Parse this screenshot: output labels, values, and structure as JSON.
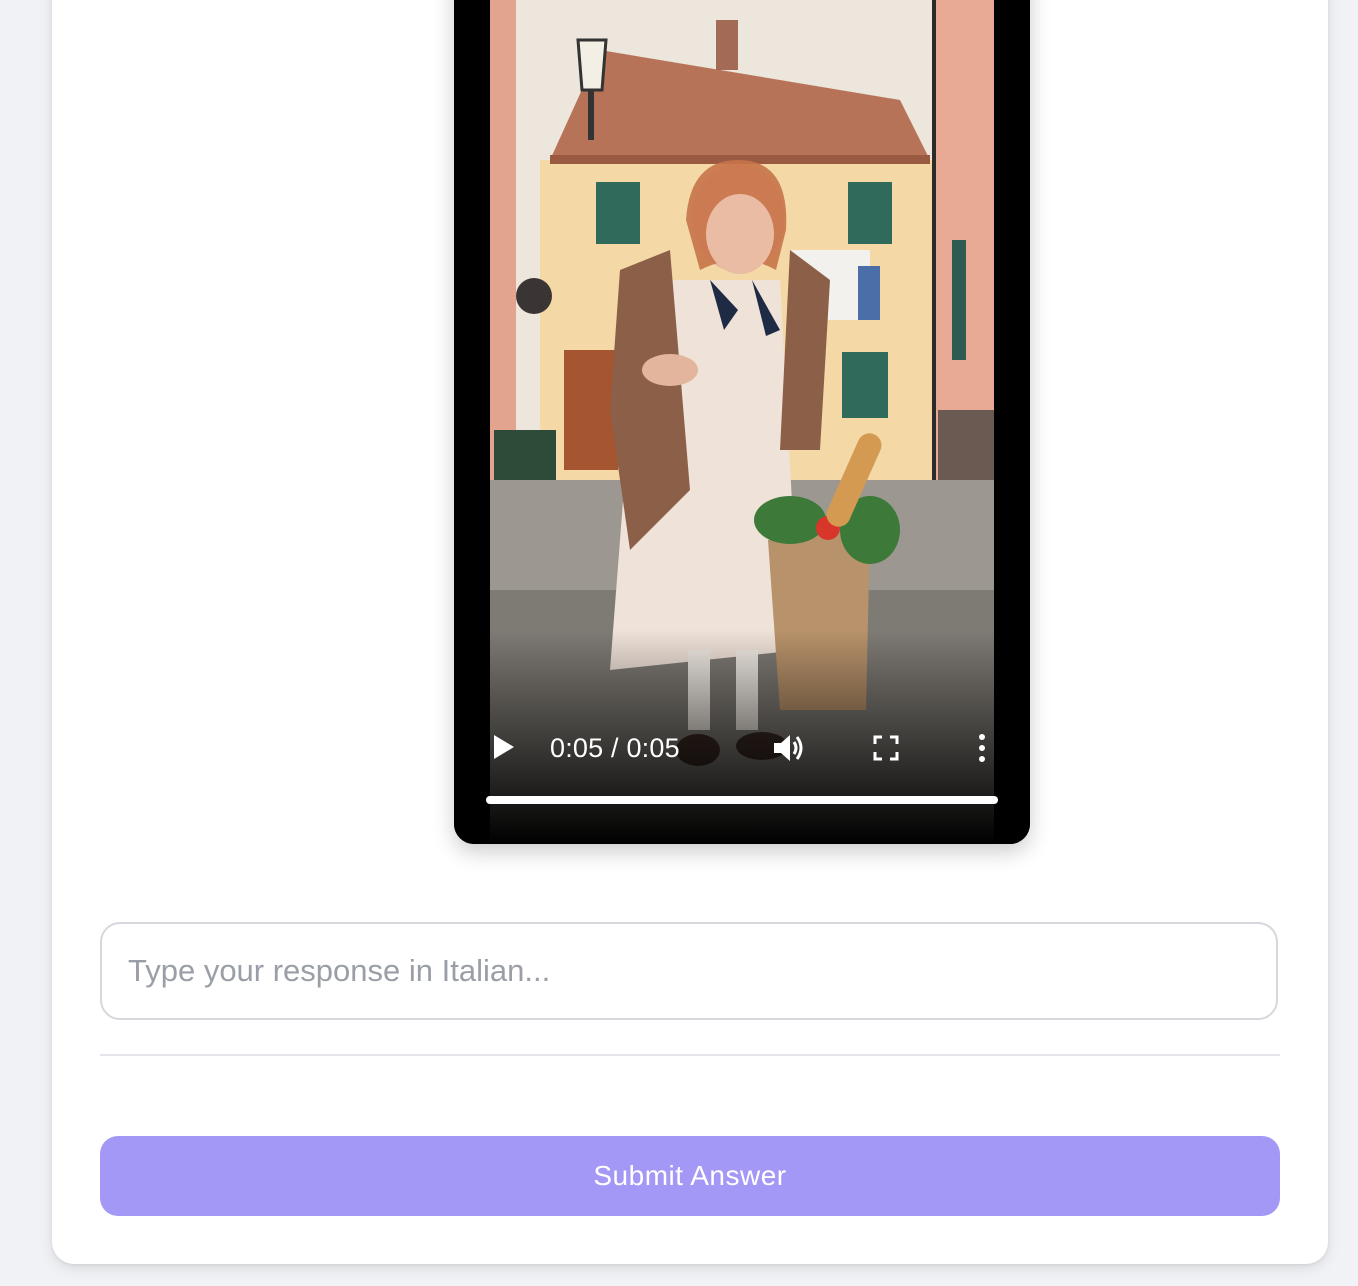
{
  "video": {
    "current_time": "0:05",
    "duration": "0:05",
    "time_separator": " / ",
    "progress": 1.0,
    "play_icon": "play-icon",
    "volume_icon": "volume-icon",
    "fullscreen_icon": "fullscreen-icon",
    "more_icon": "more-vertical-icon",
    "scene": "Elderly woman in headscarf and floral dress holding a paper grocery bag with baguette and vegetables on an Italian street"
  },
  "response": {
    "placeholder": "Type your response in Italian...",
    "value": ""
  },
  "submit": {
    "label": "Submit Answer",
    "color": "#a398f5"
  },
  "colors": {
    "page_background": "#f1f2f5",
    "card_background": "#ffffff",
    "button_text": "#ffffff",
    "placeholder_text": "#9a9ea7"
  }
}
